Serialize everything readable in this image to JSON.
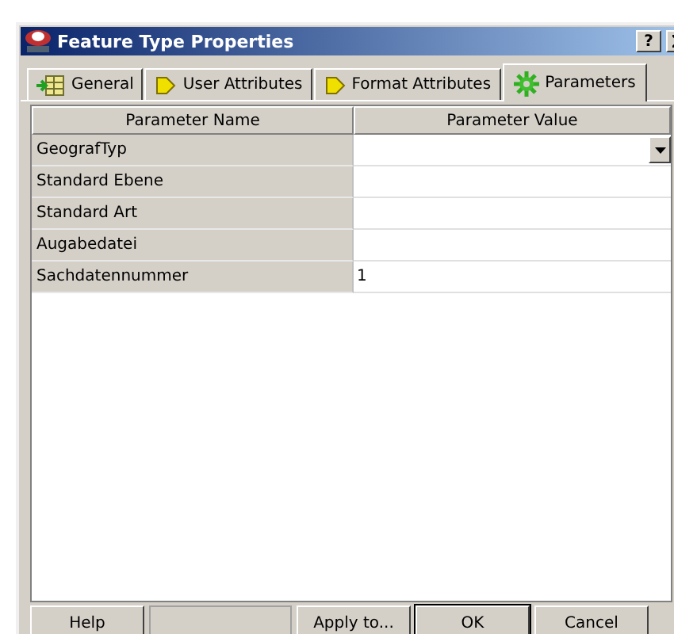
{
  "window": {
    "title": "Feature Type Properties",
    "help_button": "?"
  },
  "tabs": [
    {
      "label": "General",
      "kind": "table",
      "selected": false
    },
    {
      "label": "User Attributes",
      "kind": "attributes",
      "selected": false
    },
    {
      "label": "Format Attributes",
      "kind": "attributes",
      "selected": false
    },
    {
      "label": "Parameters",
      "kind": "parameters",
      "selected": true
    }
  ],
  "table": {
    "columns": [
      "Parameter Name",
      "Parameter Value"
    ],
    "rows": [
      {
        "name": "GeografTyp",
        "value": "",
        "kind": "dropdown"
      },
      {
        "name": "Standard Ebene",
        "value": "",
        "kind": "text"
      },
      {
        "name": "Standard Art",
        "value": "",
        "kind": "text"
      },
      {
        "name": "Augabedatei",
        "value": "",
        "kind": "text"
      },
      {
        "name": "Sachdatennummer",
        "value": "1",
        "kind": "text"
      }
    ]
  },
  "buttons": [
    {
      "label": "Help",
      "kind": "left"
    },
    {
      "label": "Apply to...",
      "kind": "right"
    },
    {
      "label": "OK",
      "kind": "default"
    },
    {
      "label": "Cancel",
      "kind": "right"
    }
  ]
}
